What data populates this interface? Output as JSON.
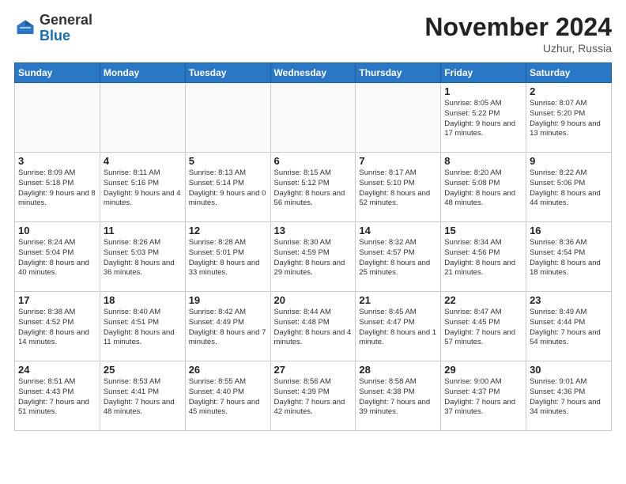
{
  "header": {
    "logo_general": "General",
    "logo_blue": "Blue",
    "month_title": "November 2024",
    "location": "Uzhur, Russia"
  },
  "days_of_week": [
    "Sunday",
    "Monday",
    "Tuesday",
    "Wednesday",
    "Thursday",
    "Friday",
    "Saturday"
  ],
  "weeks": [
    [
      {
        "day": "",
        "info": ""
      },
      {
        "day": "",
        "info": ""
      },
      {
        "day": "",
        "info": ""
      },
      {
        "day": "",
        "info": ""
      },
      {
        "day": "",
        "info": ""
      },
      {
        "day": "1",
        "info": "Sunrise: 8:05 AM\nSunset: 5:22 PM\nDaylight: 9 hours and 17 minutes."
      },
      {
        "day": "2",
        "info": "Sunrise: 8:07 AM\nSunset: 5:20 PM\nDaylight: 9 hours and 13 minutes."
      }
    ],
    [
      {
        "day": "3",
        "info": "Sunrise: 8:09 AM\nSunset: 5:18 PM\nDaylight: 9 hours and 8 minutes."
      },
      {
        "day": "4",
        "info": "Sunrise: 8:11 AM\nSunset: 5:16 PM\nDaylight: 9 hours and 4 minutes."
      },
      {
        "day": "5",
        "info": "Sunrise: 8:13 AM\nSunset: 5:14 PM\nDaylight: 9 hours and 0 minutes."
      },
      {
        "day": "6",
        "info": "Sunrise: 8:15 AM\nSunset: 5:12 PM\nDaylight: 8 hours and 56 minutes."
      },
      {
        "day": "7",
        "info": "Sunrise: 8:17 AM\nSunset: 5:10 PM\nDaylight: 8 hours and 52 minutes."
      },
      {
        "day": "8",
        "info": "Sunrise: 8:20 AM\nSunset: 5:08 PM\nDaylight: 8 hours and 48 minutes."
      },
      {
        "day": "9",
        "info": "Sunrise: 8:22 AM\nSunset: 5:06 PM\nDaylight: 8 hours and 44 minutes."
      }
    ],
    [
      {
        "day": "10",
        "info": "Sunrise: 8:24 AM\nSunset: 5:04 PM\nDaylight: 8 hours and 40 minutes."
      },
      {
        "day": "11",
        "info": "Sunrise: 8:26 AM\nSunset: 5:03 PM\nDaylight: 8 hours and 36 minutes."
      },
      {
        "day": "12",
        "info": "Sunrise: 8:28 AM\nSunset: 5:01 PM\nDaylight: 8 hours and 33 minutes."
      },
      {
        "day": "13",
        "info": "Sunrise: 8:30 AM\nSunset: 4:59 PM\nDaylight: 8 hours and 29 minutes."
      },
      {
        "day": "14",
        "info": "Sunrise: 8:32 AM\nSunset: 4:57 PM\nDaylight: 8 hours and 25 minutes."
      },
      {
        "day": "15",
        "info": "Sunrise: 8:34 AM\nSunset: 4:56 PM\nDaylight: 8 hours and 21 minutes."
      },
      {
        "day": "16",
        "info": "Sunrise: 8:36 AM\nSunset: 4:54 PM\nDaylight: 8 hours and 18 minutes."
      }
    ],
    [
      {
        "day": "17",
        "info": "Sunrise: 8:38 AM\nSunset: 4:52 PM\nDaylight: 8 hours and 14 minutes."
      },
      {
        "day": "18",
        "info": "Sunrise: 8:40 AM\nSunset: 4:51 PM\nDaylight: 8 hours and 11 minutes."
      },
      {
        "day": "19",
        "info": "Sunrise: 8:42 AM\nSunset: 4:49 PM\nDaylight: 8 hours and 7 minutes."
      },
      {
        "day": "20",
        "info": "Sunrise: 8:44 AM\nSunset: 4:48 PM\nDaylight: 8 hours and 4 minutes."
      },
      {
        "day": "21",
        "info": "Sunrise: 8:45 AM\nSunset: 4:47 PM\nDaylight: 8 hours and 1 minute."
      },
      {
        "day": "22",
        "info": "Sunrise: 8:47 AM\nSunset: 4:45 PM\nDaylight: 7 hours and 57 minutes."
      },
      {
        "day": "23",
        "info": "Sunrise: 8:49 AM\nSunset: 4:44 PM\nDaylight: 7 hours and 54 minutes."
      }
    ],
    [
      {
        "day": "24",
        "info": "Sunrise: 8:51 AM\nSunset: 4:43 PM\nDaylight: 7 hours and 51 minutes."
      },
      {
        "day": "25",
        "info": "Sunrise: 8:53 AM\nSunset: 4:41 PM\nDaylight: 7 hours and 48 minutes."
      },
      {
        "day": "26",
        "info": "Sunrise: 8:55 AM\nSunset: 4:40 PM\nDaylight: 7 hours and 45 minutes."
      },
      {
        "day": "27",
        "info": "Sunrise: 8:56 AM\nSunset: 4:39 PM\nDaylight: 7 hours and 42 minutes."
      },
      {
        "day": "28",
        "info": "Sunrise: 8:58 AM\nSunset: 4:38 PM\nDaylight: 7 hours and 39 minutes."
      },
      {
        "day": "29",
        "info": "Sunrise: 9:00 AM\nSunset: 4:37 PM\nDaylight: 7 hours and 37 minutes."
      },
      {
        "day": "30",
        "info": "Sunrise: 9:01 AM\nSunset: 4:36 PM\nDaylight: 7 hours and 34 minutes."
      }
    ]
  ]
}
